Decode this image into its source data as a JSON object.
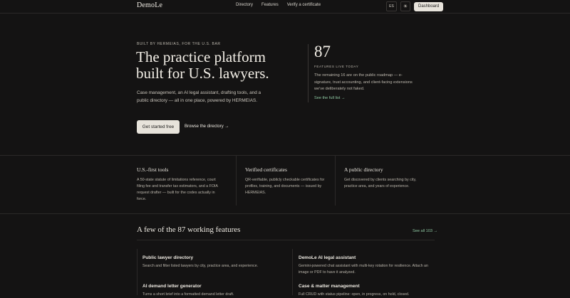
{
  "brand": "DemoLe",
  "nav": {
    "links": [
      "Directory",
      "Features",
      "Verify a certificate"
    ]
  },
  "header_actions": {
    "lang": "ES",
    "theme_icon": "sun-icon",
    "dashboard": "Dashboard"
  },
  "hero": {
    "eyebrow": "BUILT BY HERMEIAS, FOR THE U.S. BAR",
    "title_line1": "The practice platform",
    "title_line2": "built for U.S. lawyers.",
    "description": "Case management, an AI legal assistant, drafting tools, and a public directory — all in one place, powered by HERMEIAS.",
    "primary_cta": "Get started free",
    "secondary_cta": "Browse the directory →"
  },
  "stat": {
    "number": "87",
    "label": "FEATURES LIVE TODAY",
    "description": "The remaining 16 are on the public roadmap — e-signature, trust accounting, and client-facing extensions we've deliberately not faked.",
    "link": "See the full list →"
  },
  "pillars": [
    {
      "title": "U.S.-first tools",
      "text": "A 50-state statute of limitations reference, court filing fee and transfer tax estimators, and a FOIA request drafter — built for the codes actually in force."
    },
    {
      "title": "Verified certificates",
      "text": "QR-verifiable, publicly checkable certificates for profiles, training, and documents — issued by HERMEIAS."
    },
    {
      "title": "A public directory",
      "text": "Get discovered by clients searching by city, practice area, and years of experience."
    }
  ],
  "features": {
    "title": "A few of the 87 working features",
    "see_all": "See all 103 →",
    "items": [
      {
        "title": "Public lawyer directory",
        "text": "Search and filter listed lawyers by city, practice area, and experience."
      },
      {
        "title": "DemoLe AI legal assistant",
        "text": "Gemini-powered chat assistant with multi-key rotation for resilience. Attach an image or PDF to have it analyzed."
      },
      {
        "title": "AI demand letter generator",
        "text": "Turns a short brief into a formatted demand letter draft."
      },
      {
        "title": "Case & matter management",
        "text": "Full CRUD with status pipeline: open, in progress, on hold, closed."
      }
    ]
  }
}
